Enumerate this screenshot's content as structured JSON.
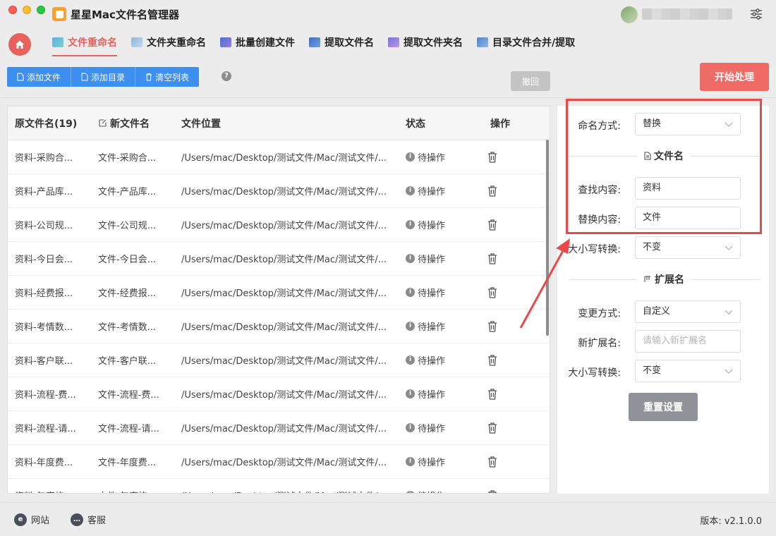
{
  "app": {
    "title": "星星Mac文件名管理器"
  },
  "nav": {
    "tabs": [
      {
        "label": "文件重命名",
        "active": true,
        "icon": "rename-file-icon"
      },
      {
        "label": "文件夹重命名",
        "active": false,
        "icon": "rename-folder-icon"
      },
      {
        "label": "批量创建文件",
        "active": false,
        "icon": "batch-create-icon"
      },
      {
        "label": "提取文件名",
        "active": false,
        "icon": "extract-filename-icon"
      },
      {
        "label": "提取文件夹名",
        "active": false,
        "icon": "extract-foldername-icon"
      },
      {
        "label": "目录文件合并/提取",
        "active": false,
        "icon": "merge-extract-icon"
      }
    ]
  },
  "toolbar": {
    "add_file": "添加文件",
    "add_dir": "添加目录",
    "clear_list": "清空列表",
    "help": "?",
    "undo": "撤回",
    "start": "开始处理"
  },
  "table": {
    "headers": {
      "orig": "原文件名(19)",
      "new": "新文件名",
      "path": "文件位置",
      "status": "状态",
      "action": "操作"
    },
    "rows": [
      {
        "orig": "资料-采购合...",
        "new": "文件-采购合...",
        "path": "/Users/mac/Desktop/测试文件/Mac/测试文件/...",
        "status": "待操作"
      },
      {
        "orig": "资料-产品库...",
        "new": "文件-产品库...",
        "path": "/Users/mac/Desktop/测试文件/Mac/测试文件/...",
        "status": "待操作"
      },
      {
        "orig": "资料-公司规...",
        "new": "文件-公司规...",
        "path": "/Users/mac/Desktop/测试文件/Mac/测试文件/...",
        "status": "待操作"
      },
      {
        "orig": "资料-今日会...",
        "new": "文件-今日会...",
        "path": "/Users/mac/Desktop/测试文件/Mac/测试文件/...",
        "status": "待操作"
      },
      {
        "orig": "资料-经费报...",
        "new": "文件-经费报...",
        "path": "/Users/mac/Desktop/测试文件/Mac/测试文件/...",
        "status": "待操作"
      },
      {
        "orig": "资料-考情数...",
        "new": "文件-考情数...",
        "path": "/Users/mac/Desktop/测试文件/Mac/测试文件/...",
        "status": "待操作"
      },
      {
        "orig": "资料-客户联...",
        "new": "文件-客户联...",
        "path": "/Users/mac/Desktop/测试文件/Mac/测试文件/...",
        "status": "待操作"
      },
      {
        "orig": "资料-流程-费...",
        "new": "文件-流程-费...",
        "path": "/Users/mac/Desktop/测试文件/Mac/测试文件/...",
        "status": "待操作"
      },
      {
        "orig": "资料-流程-请...",
        "new": "文件-流程-请...",
        "path": "/Users/mac/Desktop/测试文件/Mac/测试文件/...",
        "status": "待操作"
      },
      {
        "orig": "资料-年度费...",
        "new": "文件-年度费...",
        "path": "/Users/mac/Desktop/测试文件/Mac/测试文件/...",
        "status": "待操作"
      },
      {
        "orig": "资料-年度旅...",
        "new": "文件-年度旅...",
        "path": "/Users/mac/Desktop/测试文件/Mac/测试文件/...",
        "status": "待操作"
      }
    ]
  },
  "panel": {
    "naming_label": "命名方式:",
    "naming_value": "替换",
    "filename_section": "文件名",
    "find_label": "查找内容:",
    "find_value": "资料",
    "replace_label": "替换内容:",
    "replace_value": "文件",
    "case_label": "大小写转换:",
    "case_value": "不变",
    "ext_section": "扩展名",
    "change_label": "变更方式:",
    "change_value": "自定义",
    "new_ext_label": "新扩展名:",
    "new_ext_placeholder": "请输入新扩展名",
    "ext_case_label": "大小写转换:",
    "ext_case_value": "不变",
    "reset": "重置设置"
  },
  "footer": {
    "website": "网站",
    "support": "客服",
    "version": "版本:  v2.1.0.0"
  },
  "colors": {
    "accent": "#e9615c",
    "primary_blue": "#3d8ff0",
    "highlight_red": "#e84a4a"
  }
}
